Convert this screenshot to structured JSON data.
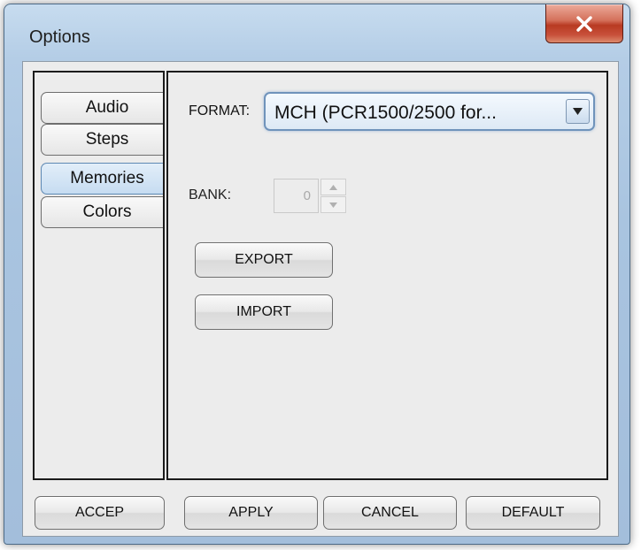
{
  "window": {
    "title": "Options",
    "close_icon": "close-x-icon",
    "colors": {
      "close_button": "#c8503a",
      "frame": "#a9c4e0",
      "client": "#ececec"
    }
  },
  "tabs": [
    {
      "label": "Audio",
      "active": false
    },
    {
      "label": "Steps",
      "active": false
    },
    {
      "label": "Memories",
      "active": true
    },
    {
      "label": "Colors",
      "active": false
    }
  ],
  "memories": {
    "format_label": "FORMAT:",
    "format_value": "MCH (PCR1500/2500 for...",
    "bank_label": "BANK:",
    "bank_value": "0",
    "export_label": "EXPORT",
    "import_label": "IMPORT"
  },
  "footer": {
    "accept_label": "ACCEP",
    "apply_label": "APPLY",
    "cancel_label": "CANCEL",
    "default_label": "DEFAULT"
  }
}
